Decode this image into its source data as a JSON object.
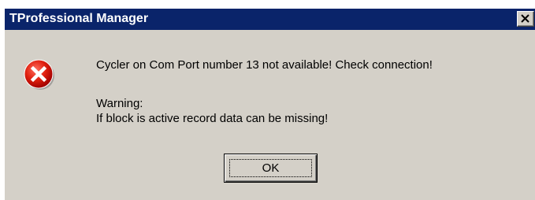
{
  "window": {
    "title": "TProfessional Manager",
    "close_icon": "close-icon",
    "titlebar_color": "#0a246a"
  },
  "dialog": {
    "icon": "error-icon",
    "message": "Cycler on Com Port number 13 not available! Check connection!",
    "warning_label": "Warning:",
    "warning_text": "If block is active record data can be missing!"
  },
  "buttons": {
    "ok_label": "OK"
  }
}
